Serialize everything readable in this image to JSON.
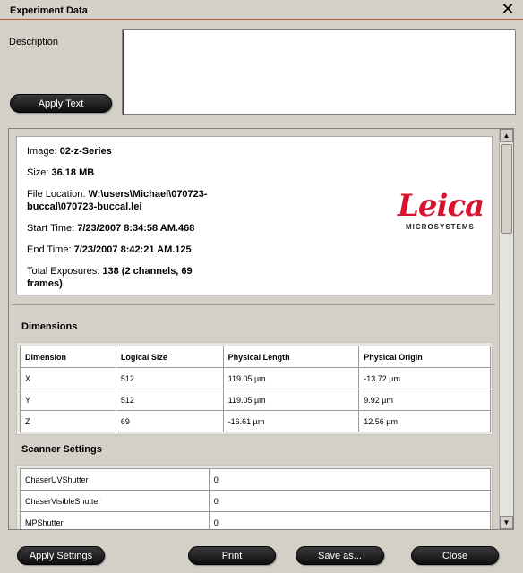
{
  "window": {
    "title": "Experiment Data",
    "close_glyph": "✕"
  },
  "description": {
    "label": "Description",
    "value": ""
  },
  "buttons": {
    "apply_text": "Apply Text",
    "apply_settings": "Apply Settings",
    "print": "Print",
    "save_as": "Save as...",
    "close": "Close"
  },
  "info": {
    "image_label": "Image: ",
    "image_value": "02-z-Series",
    "size_label": "Size: ",
    "size_value": "36.18 MB",
    "file_label": "File Location: ",
    "file_value_1": "W:\\users\\Michael\\070723-",
    "file_value_2": "buccal\\070723-buccal.lei",
    "start_label": "Start Time: ",
    "start_value": "7/23/2007 8:34:58 AM.468",
    "end_label": "End Time: ",
    "end_value": "7/23/2007 8:42:21 AM.125",
    "exposures_label": "Total Exposures: ",
    "exposures_value_1": "138 (2 channels, 69",
    "exposures_value_2": "frames)"
  },
  "logo": {
    "brand": "Leica",
    "sub": "MICROSYSTEMS"
  },
  "dimensions": {
    "title": "Dimensions",
    "headers": [
      "Dimension",
      "Logical Size",
      "Physical Length",
      "Physical Origin"
    ],
    "rows": [
      [
        "X",
        "512",
        "119.05 µm",
        "-13.72 µm"
      ],
      [
        "Y",
        "512",
        "119.05 µm",
        "9.92 µm"
      ],
      [
        "Z",
        "69",
        "-16.61 µm",
        "12.56 µm"
      ]
    ]
  },
  "scanner": {
    "title": "Scanner Settings",
    "rows": [
      [
        "ChaserUVShutter",
        "0"
      ],
      [
        "ChaserVisibleShutter",
        "0"
      ],
      [
        "MPShutter",
        "0"
      ]
    ]
  },
  "scrollbar": {
    "up_glyph": "▲",
    "down_glyph": "▼"
  }
}
